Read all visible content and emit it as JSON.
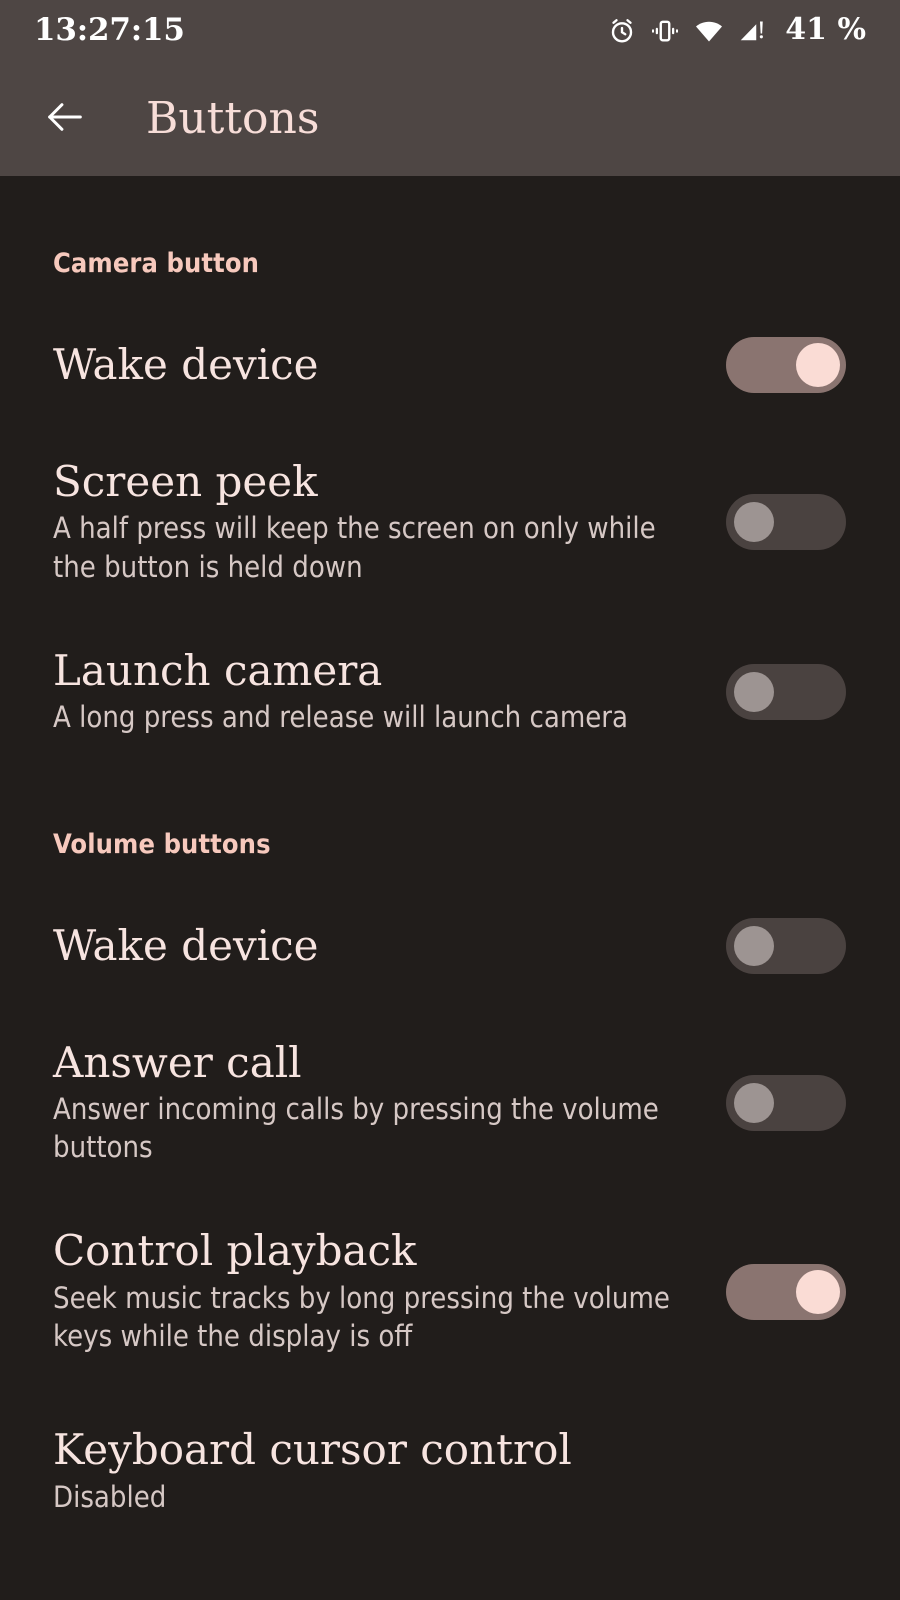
{
  "statusbar": {
    "time": "13:27:15",
    "battery": "41 %",
    "icons": [
      "alarm-icon",
      "vibrate-icon",
      "wifi-icon",
      "cellular-signal-warning-icon"
    ]
  },
  "appbar": {
    "back_icon": "arrow-left-icon",
    "title": "Buttons"
  },
  "sections": [
    {
      "header": "Camera button",
      "items": [
        {
          "title": "Wake device",
          "desc": "",
          "toggle": "on"
        },
        {
          "title": "Screen peek",
          "desc": "A half press will keep the screen on only while the button is held down",
          "toggle": "off"
        },
        {
          "title": "Launch camera",
          "desc": "A long press and release will launch camera",
          "toggle": "off"
        }
      ]
    },
    {
      "header": "Volume buttons",
      "items": [
        {
          "title": "Wake device",
          "desc": "",
          "toggle": "off"
        },
        {
          "title": "Answer call",
          "desc": "Answer incoming calls by pressing the volume buttons",
          "toggle": "off"
        },
        {
          "title": "Control playback",
          "desc": "Seek music tracks by long pressing the volume keys while the display is off",
          "toggle": "on"
        },
        {
          "title": "Keyboard cursor control",
          "desc": "Disabled",
          "toggle": "none"
        }
      ]
    }
  ],
  "colors": {
    "appbar_bg": "#4e4644",
    "page_bg": "#211d1b",
    "accent_header": "#f7c9bd",
    "title_text": "#f7e4e0",
    "desc_text": "#d6c8c5",
    "toggle_on_track": "#8a7470",
    "toggle_on_knob": "#fadcd5",
    "toggle_off_track": "#4a4240",
    "toggle_off_knob": "#9d9492"
  }
}
